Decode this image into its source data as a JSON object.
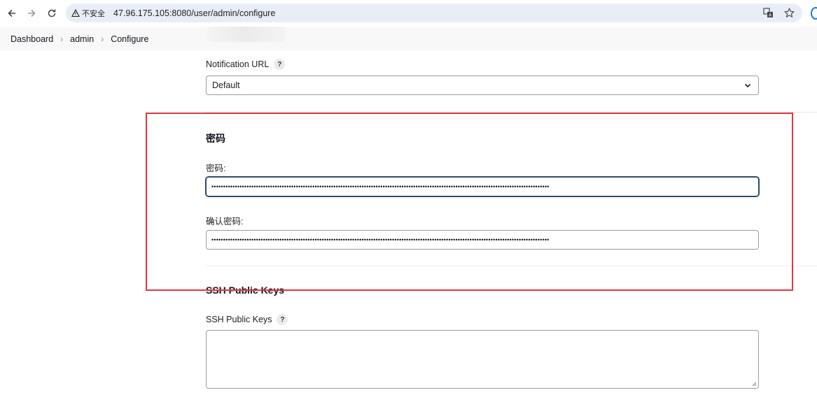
{
  "browser": {
    "security_label": "不安全",
    "url": "47.96.175.105:8080/user/admin/configure",
    "icons": [
      "back-arrow-icon",
      "forward-arrow-icon",
      "reload-icon",
      "warning-triangle-icon",
      "translate-icon",
      "star-icon"
    ]
  },
  "breadcrumb": {
    "items": [
      "Dashboard",
      "admin",
      "Configure"
    ]
  },
  "form": {
    "notification_url": {
      "label": "Notification URL",
      "help": "?",
      "selected": "Default"
    },
    "password_section": {
      "title": "密码",
      "password_label": "密码:",
      "password_value": "••••••••••••••••••••••••••••••••••••••••••••••••••••••••••••••••••••••••••••••••••••••••••••••••••••••••••••••••••••••••••••••••••••••••••••••••",
      "confirm_label": "确认密码:",
      "confirm_value": "••••••••••••••••••••••••••••••••••••••••••••••••••••••••••••••••••••••••••••••••••••••••••••••••••••••••••••••••••••••••••••••••••••••••••••••••"
    },
    "ssh_section": {
      "title": "SSH Public Keys",
      "field_label": "SSH Public Keys",
      "help": "?",
      "value": ""
    }
  },
  "colors": {
    "highlight": "#e0383e",
    "focus": "#2f4b62",
    "omnibox": "#e9eef6"
  }
}
